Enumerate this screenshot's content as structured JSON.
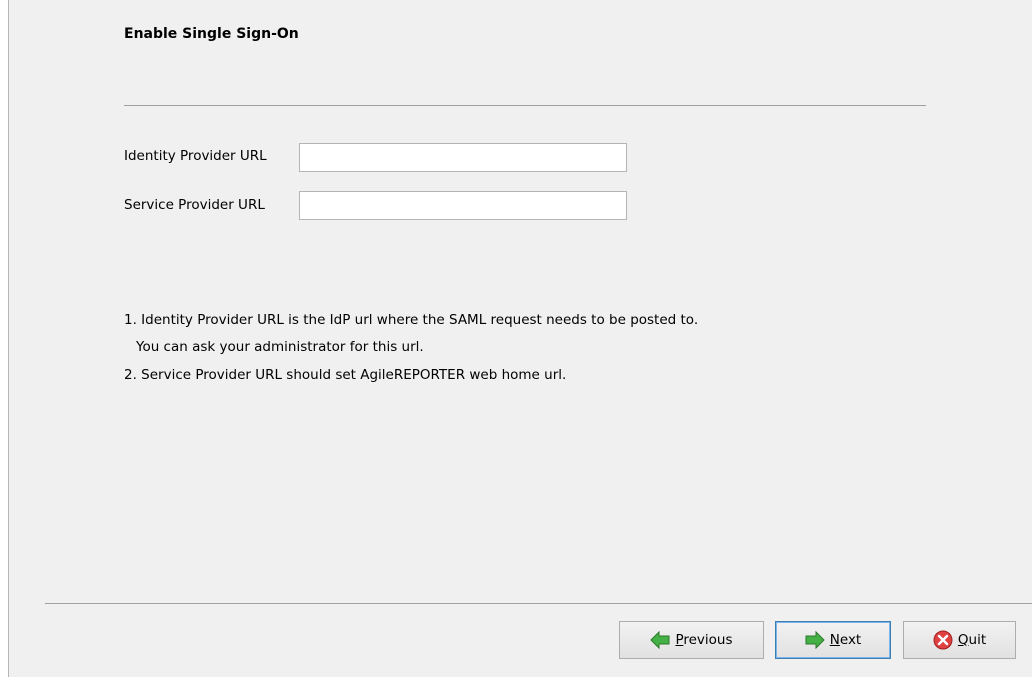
{
  "header": {
    "title": "Enable Single Sign-On"
  },
  "form": {
    "idp_label": "Identity Provider URL",
    "idp_value": "",
    "sp_label": "Service Provider URL",
    "sp_value": ""
  },
  "notes": {
    "line1": "1. Identity Provider URL is the IdP url where the SAML request needs to be posted to.",
    "line2": "You can ask your administrator for this url.",
    "line3": "2. Service Provider URL should set AgileREPORTER web home url."
  },
  "buttons": {
    "previous": {
      "mnemonic": "P",
      "rest": "revious",
      "icon": "arrow-left-icon",
      "color": "#3aa63a"
    },
    "next": {
      "mnemonic": "N",
      "rest": "ext",
      "icon": "arrow-right-icon",
      "color": "#3aa63a"
    },
    "quit": {
      "mnemonic": "Q",
      "rest": "uit",
      "icon": "close-circle-icon",
      "color": "#d93b3b"
    }
  }
}
